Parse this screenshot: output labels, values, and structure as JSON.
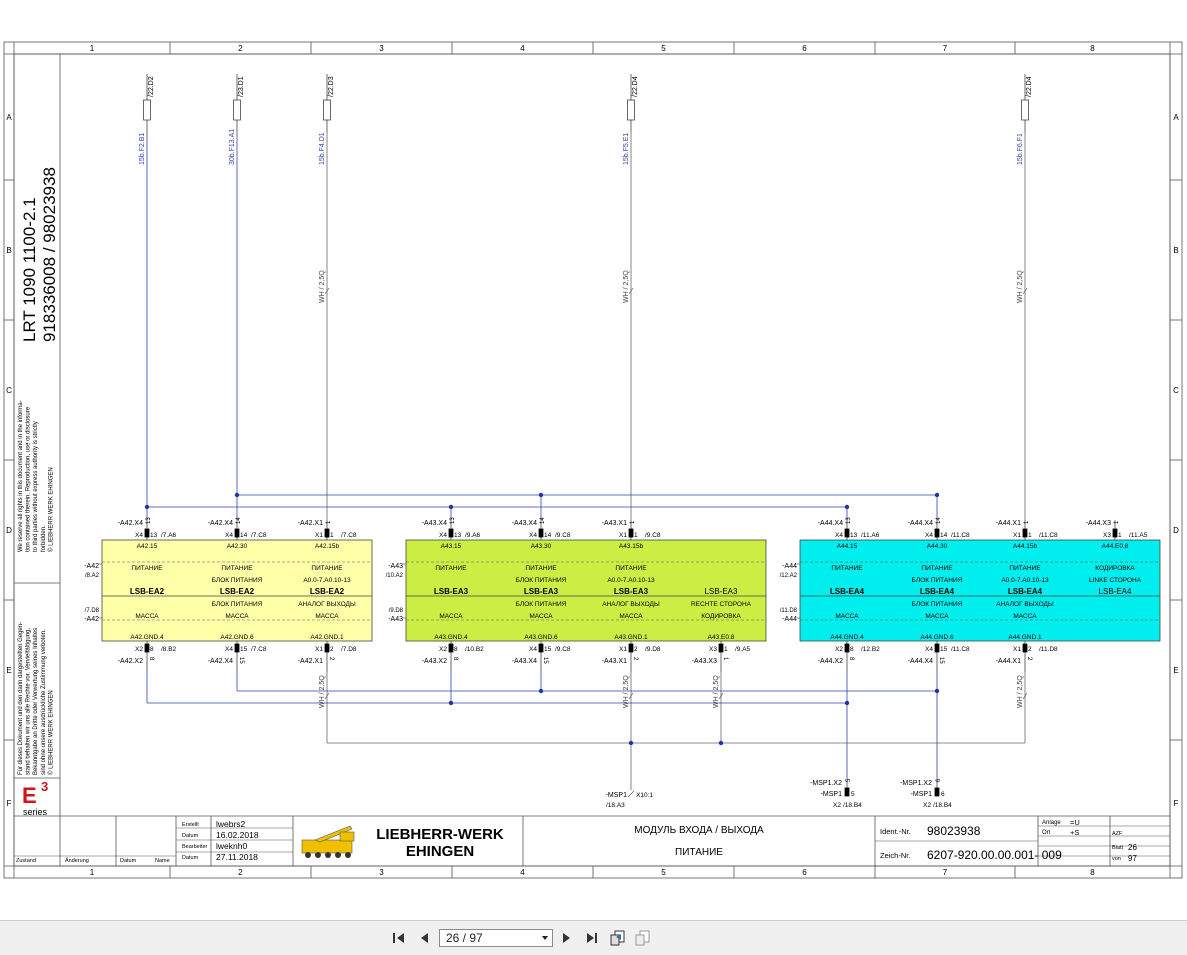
{
  "sheet": {
    "col_labels": [
      "1",
      "2",
      "3",
      "4",
      "5",
      "6",
      "7",
      "8"
    ],
    "row_labels": [
      "A",
      "B",
      "C",
      "D",
      "E",
      "F"
    ]
  },
  "side": {
    "title": "LRT 1090 1100-2.1",
    "numbers": "918336008  /  98023938",
    "notice_en": [
      "We reserve all rights in this document and in the informa-",
      "tion contained therein. Reproduction, use or disclosure",
      "to third parties without express authority is strictly",
      "forbidden.",
      "© LIEBHERR WERK EHINGEN"
    ],
    "notice_de": [
      "Für dieses Dokument und den darin dargestellten Gegen-",
      "stand behalten wir uns alle Rechte vor. Vervielfältigung,",
      "Bekanntgabe an Dritte oder Verwertung seines Inhaltes",
      "sind ohne unsere ausdrückliche Zustimmung verboten.",
      "© LIEBHERR WERK EHINGEN"
    ],
    "logo_text": "E",
    "logo_sup": "3",
    "logo_series": "series"
  },
  "fuses": [
    {
      "ref": "/22.D2",
      "wire": "15b.F2.B1"
    },
    {
      "ref": "/23.D1",
      "wire": "30b.F13.A1"
    },
    {
      "ref": "/22.D3",
      "wire": "15b.F4.D1"
    },
    {
      "ref": "/22.D4",
      "wire": "15b.F5.E1"
    },
    {
      "ref": "/22.D4",
      "wire": "15b.F6.F1"
    }
  ],
  "wire_size": "WH / 2,5Q",
  "modules": [
    {
      "prefix": "-A42",
      "side_ref_top": "/8.A2",
      "side_ref_bot": "/7.D8",
      "color": "#ffffa8",
      "top_pins": [
        {
          "tag": "-A42.X4",
          "con": "X4",
          "pin": "13",
          "ref": "/7.A6",
          "sig": "A42.15"
        },
        {
          "tag": "-A42.X4",
          "con": "X4",
          "pin": "14",
          "ref": "/7.C8",
          "sig": "A42.30"
        },
        {
          "tag": "-A42.X1",
          "con": "X1",
          "pin": "1",
          "ref": "/7.C8",
          "sig": "A42.15b"
        }
      ],
      "bot_pins": [
        {
          "tag": "-A42.X2",
          "con": "X2",
          "pin": "8",
          "ref": "/8.B2",
          "sig": "A42.GND.4"
        },
        {
          "tag": "-A42.X4",
          "con": "X4",
          "pin": "15",
          "ref": "/7.C8",
          "sig": "A42.GND.6"
        },
        {
          "tag": "-A42.X1",
          "con": "X1",
          "pin": "2",
          "ref": "/7.D8",
          "sig": "A42.GND.1"
        }
      ],
      "cols": [
        {
          "l1": "ПИТАНИЕ",
          "l2": "",
          "name": "LSB-EA2",
          "l3": "",
          "l4": "МАССА"
        },
        {
          "l1": "ПИТАНИЕ",
          "l2": "БЛОК ПИТАНИЯ",
          "name": "LSB-EA2",
          "l3": "БЛОК ПИТАНИЯ",
          "l4": "МАССА"
        },
        {
          "l1": "ПИТАНИЕ",
          "l2": "A0.0-7.A0.10-13",
          "name": "LSB-EA2",
          "l3": "АНАЛОГ ВЫХОДЫ",
          "l4": "МАССА"
        }
      ]
    },
    {
      "prefix": "-A43",
      "side_ref_top": "/10.A2",
      "side_ref_bot": "/9.D8",
      "color": "#ccee44",
      "top_pins": [
        {
          "tag": "-A43.X4",
          "con": "X4",
          "pin": "13",
          "ref": "/9.A6",
          "sig": "A43.15"
        },
        {
          "tag": "-A43.X4",
          "con": "X4",
          "pin": "14",
          "ref": "/9.C8",
          "sig": "A43.30"
        },
        {
          "tag": "-A43.X1",
          "con": "X1",
          "pin": "1",
          "ref": "/9.C8",
          "sig": "A43.15b"
        }
      ],
      "bot_pins": [
        {
          "tag": "-A43.X2",
          "con": "X2",
          "pin": "8",
          "ref": "/10.B2",
          "sig": "A43.GND.4"
        },
        {
          "tag": "-A43.X4",
          "con": "X4",
          "pin": "15",
          "ref": "/9.C8",
          "sig": "A43.GND.6"
        },
        {
          "tag": "-A43.X1",
          "con": "X1",
          "pin": "2",
          "ref": "/9.D8",
          "sig": "A43.GND.1"
        },
        {
          "tag": "-A43.X3",
          "con": "X3",
          "pin": "1",
          "ref": "/9.A5",
          "sig": "A43.E0.8"
        }
      ],
      "cols": [
        {
          "l1": "ПИТАНИЕ",
          "l2": "",
          "name": "LSB-EA3",
          "l3": "",
          "l4": "МАССА"
        },
        {
          "l1": "ПИТАНИЕ",
          "l2": "БЛОК ПИТАНИЯ",
          "name": "LSB-EA3",
          "l3": "БЛОК ПИТАНИЯ",
          "l4": "МАССА"
        },
        {
          "l1": "ПИТАНИЕ",
          "l2": "A0.0-7.A0.10-13",
          "name": "LSB-EA3",
          "l3": "АНАЛОГ ВЫХОДЫ",
          "l4": "МАССА"
        },
        {
          "l1": "",
          "l2": "",
          "name": "LSB-EA3",
          "l3": "RECHTE СТОРОНА",
          "l4": "КОДИРОВКА"
        }
      ]
    },
    {
      "prefix": "-A44",
      "side_ref_top": "/12.A2",
      "side_ref_bot": "/11.D8",
      "color": "#00eeee",
      "top_pins": [
        {
          "tag": "-A44.X4",
          "con": "X4",
          "pin": "13",
          "ref": "/11.A6",
          "sig": "A44.15"
        },
        {
          "tag": "-A44.X4",
          "con": "X4",
          "pin": "14",
          "ref": "/11.C8",
          "sig": "A44.30"
        },
        {
          "tag": "-A44.X1",
          "con": "X1",
          "pin": "1",
          "ref": "/11.C8",
          "sig": "A44.15b"
        },
        {
          "tag": "-A44.X3",
          "con": "X3",
          "pin": "1",
          "ref": "/11.A5",
          "sig": "A44.E0.8"
        }
      ],
      "bot_pins": [
        {
          "tag": "-A44.X2",
          "con": "X2",
          "pin": "8",
          "ref": "/12.B2",
          "sig": "A44.GND.4"
        },
        {
          "tag": "-A44.X4",
          "con": "X4",
          "pin": "15",
          "ref": "/11.C8",
          "sig": "A44.GND.6"
        },
        {
          "tag": "-A44.X1",
          "con": "X1",
          "pin": "2",
          "ref": "/11.D8",
          "sig": "A44.GND.1"
        }
      ],
      "cols": [
        {
          "l1": "ПИТАНИЕ",
          "l2": "",
          "name": "LSB-EA4",
          "l3": "",
          "l4": "МАССА"
        },
        {
          "l1": "ПИТАНИЕ",
          "l2": "БЛОК ПИТАНИЯ",
          "name": "LSB-EA4",
          "l3": "БЛОК ПИТАНИЯ",
          "l4": "МАССА"
        },
        {
          "l1": "ПИТАНИЕ",
          "l2": "A0.0-7.A0.10-13",
          "name": "LSB-EA4",
          "l3": "АНАЛОГ ВЫХОДЫ",
          "l4": "МАССА"
        },
        {
          "l1": "КОДИРОВКА",
          "l2": "LINKE СТОРОНА",
          "name": "LSB-EA4",
          "l3": "",
          "l4": ""
        }
      ]
    }
  ],
  "msp": {
    "t1": {
      "tag": "-MSP1",
      "con": "X10:1",
      "ref": "/18.A3"
    },
    "t2": {
      "tag1": "-MSP1.X2",
      "pin1": "5",
      "tag2": "-MSP1",
      "pin2": "5",
      "con": "X2",
      "ref": "/18.B4"
    },
    "t3": {
      "tag1": "-MSP1.X2",
      "pin1": "6",
      "tag2": "-MSP1",
      "pin2": "6",
      "con": "X2",
      "ref": "/18.B4"
    }
  },
  "titleblock": {
    "rows": [
      {
        "k": "Erstellt",
        "v": "lwebrs2"
      },
      {
        "k": "Datum",
        "v": "16.02.2018"
      },
      {
        "k": "Bearbeiter",
        "v": "lweknh0"
      },
      {
        "k": "Datum",
        "v": "27.11.2018"
      }
    ],
    "rev_headers": [
      "Zustand",
      "Änderung",
      "Datum",
      "Name"
    ],
    "company_l1": "LIEBHERR-WERK",
    "company_l2": "EHINGEN",
    "desc1": "МОДУЛЬ ВХОДА / ВЫХОДА",
    "desc2": "ПИТАНИЕ",
    "ident_label": "Ident.-Nr.",
    "ident": "98023938",
    "zeich_label": "Zeich-Nr.",
    "zeich": "6207-920.00.00.001- 009",
    "anlage_label": "Anlage",
    "anlage": "=U",
    "ort_label": "Ort",
    "ort": "+S",
    "azf_label": "AZF",
    "blatt_label": "Blatt",
    "blatt": "26",
    "von_label": "von",
    "von": "97"
  },
  "viewer": {
    "page_value": "26 / 97"
  }
}
